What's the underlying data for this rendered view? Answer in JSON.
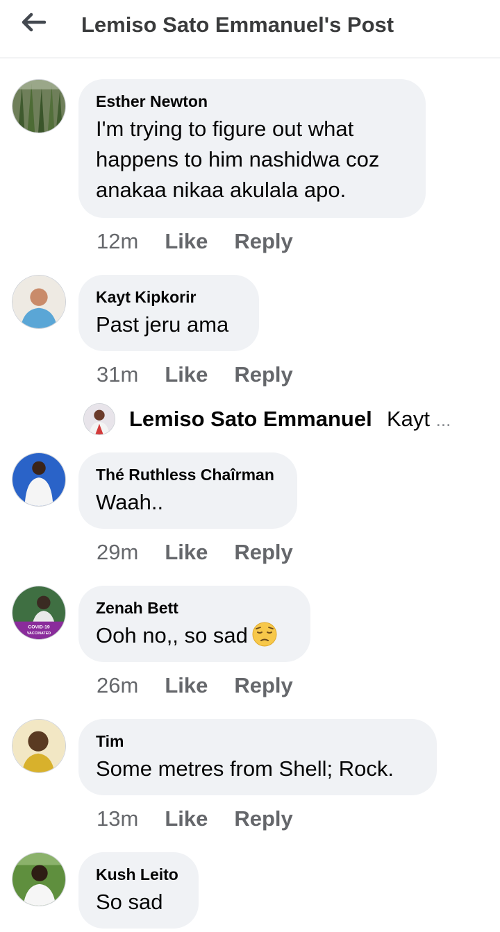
{
  "header": {
    "title": "Lemiso Sato Emmanuel's Post",
    "back_icon": "back-arrow-icon"
  },
  "actions": {
    "like": "Like",
    "reply": "Reply"
  },
  "comments": [
    {
      "name": "Esther Newton",
      "lines": [
        "I'm trying to figure out what",
        "happens to him nashidwa coz",
        "anakaa nikaa akulala apo."
      ],
      "time": "12m"
    },
    {
      "name": "Kayt Kipkorir",
      "lines": [
        "Past jeru ama"
      ],
      "time": "31m"
    },
    {
      "name": "Thé Ruthless Chaîrman",
      "lines": [
        "Waah.."
      ],
      "time": "29m"
    },
    {
      "name": "Zenah Bett",
      "lines": [
        "Ooh no,, so sad"
      ],
      "emoji": "pensive-face-emoji",
      "time": "26m"
    },
    {
      "name": "Tim",
      "lines": [
        "Some metres from Shell; Rock."
      ],
      "time": "13m"
    },
    {
      "name": "Kush Leito",
      "lines": [
        "So sad"
      ]
    }
  ],
  "reply_preview": {
    "name": "Lemiso Sato Emmanuel",
    "snippet": "Kayt",
    "more": "..."
  },
  "avatar_badge": {
    "line1": "COVID-19",
    "line2": "VACCINATED"
  }
}
